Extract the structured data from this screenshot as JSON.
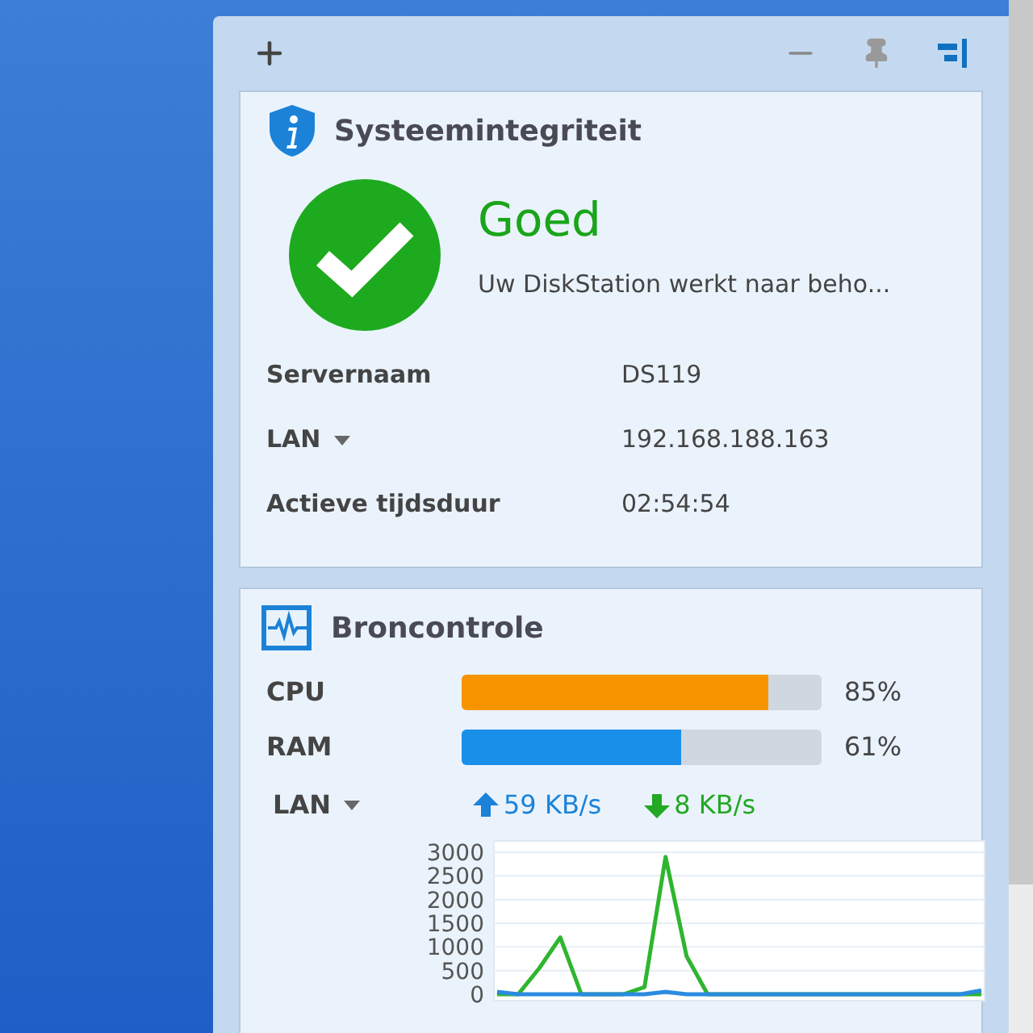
{
  "health": {
    "title": "Systeemintegriteit",
    "status": "Goed",
    "message": "Uw DiskStation werkt naar beho...",
    "rows": [
      {
        "label": "Servernaam",
        "value": "DS119",
        "dropdown": false
      },
      {
        "label": "LAN",
        "value": "192.168.188.163",
        "dropdown": true
      },
      {
        "label": "Actieve tijdsduur",
        "value": "02:54:54",
        "dropdown": false
      }
    ]
  },
  "resources": {
    "title": "Broncontrole",
    "meters": [
      {
        "label": "CPU",
        "level": 0.85,
        "reading": "85%",
        "color": "#f79400"
      },
      {
        "label": "RAM",
        "level": 0.61,
        "reading": "61%",
        "color": "#1a8fea"
      }
    ],
    "network": {
      "label": "LAN",
      "upload": "59 KB/s",
      "download": "8 KB/s",
      "chart_data": {
        "type": "line",
        "grid": true,
        "ylim": [
          0,
          3000
        ],
        "yticks": [
          0,
          500,
          1000,
          1500,
          2000,
          2500,
          3000
        ],
        "series": [
          {
            "color": "#2fb52f",
            "values": [
              0,
              0,
              550,
              1200,
              0,
              0,
              0,
              150,
              2900,
              800,
              0,
              0,
              0,
              0,
              0,
              0,
              0,
              0,
              0,
              0,
              0,
              0,
              0,
              0
            ]
          },
          {
            "color": "#2a8be0",
            "values": [
              50,
              0,
              0,
              0,
              0,
              0,
              0,
              0,
              50,
              0,
              0,
              0,
              0,
              0,
              0,
              0,
              0,
              0,
              0,
              0,
              0,
              0,
              0,
              80
            ]
          }
        ]
      }
    }
  }
}
